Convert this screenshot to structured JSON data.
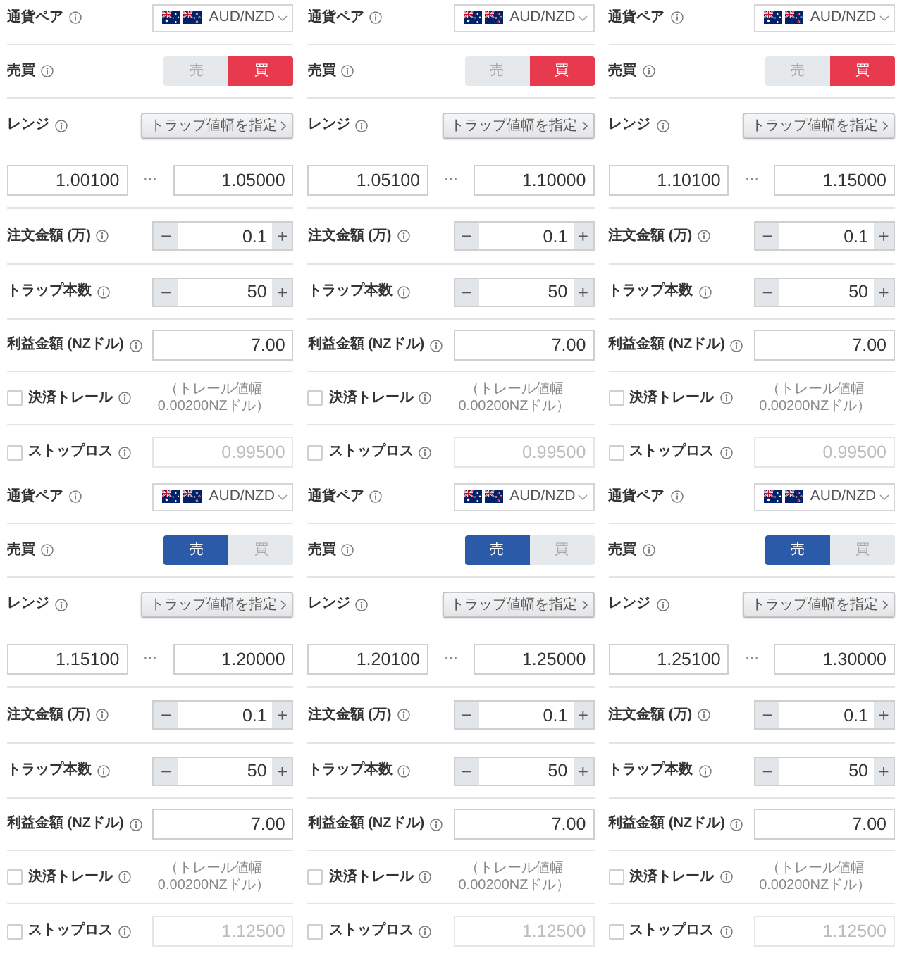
{
  "panels": [
    {
      "currency_pair": {
        "label": "通貨ペア",
        "value": "AUD/NZD"
      },
      "side": {
        "label": "売買",
        "options": [
          {
            "kind": "sell",
            "label": "売",
            "selected": false
          },
          {
            "kind": "buy",
            "label": "買",
            "selected": true
          }
        ]
      },
      "range": {
        "label": "レンジ",
        "button": "トラップ値幅を指定",
        "from": "1.00100",
        "separator": "⋯",
        "to": "1.05000"
      },
      "order_amount": {
        "label": "注文金額 (万)",
        "minus": "−",
        "value": "0.1",
        "plus": "+"
      },
      "trap_count": {
        "label": "トラップ本数",
        "minus": "−",
        "value": "50",
        "plus": "+"
      },
      "profit": {
        "label": "利益金額 (NZドル)",
        "value": "7.00"
      },
      "trail": {
        "label": "決済トレール",
        "checked": false,
        "note": "（トレール値幅 0.00200NZドル）"
      },
      "stop_loss": {
        "label": "ストップロス",
        "checked": false,
        "value": "0.99500"
      }
    },
    {
      "currency_pair": {
        "label": "通貨ペア",
        "value": "AUD/NZD"
      },
      "side": {
        "label": "売買",
        "options": [
          {
            "kind": "sell",
            "label": "売",
            "selected": false
          },
          {
            "kind": "buy",
            "label": "買",
            "selected": true
          }
        ]
      },
      "range": {
        "label": "レンジ",
        "button": "トラップ値幅を指定",
        "from": "1.05100",
        "separator": "⋯",
        "to": "1.10000"
      },
      "order_amount": {
        "label": "注文金額 (万)",
        "minus": "−",
        "value": "0.1",
        "plus": "+"
      },
      "trap_count": {
        "label": "トラップ本数",
        "minus": "−",
        "value": "50",
        "plus": "+"
      },
      "profit": {
        "label": "利益金額 (NZドル)",
        "value": "7.00"
      },
      "trail": {
        "label": "決済トレール",
        "checked": false,
        "note": "（トレール値幅 0.00200NZドル）"
      },
      "stop_loss": {
        "label": "ストップロス",
        "checked": false,
        "value": "0.99500"
      }
    },
    {
      "currency_pair": {
        "label": "通貨ペア",
        "value": "AUD/NZD"
      },
      "side": {
        "label": "売買",
        "options": [
          {
            "kind": "sell",
            "label": "売",
            "selected": false
          },
          {
            "kind": "buy",
            "label": "買",
            "selected": true
          }
        ]
      },
      "range": {
        "label": "レンジ",
        "button": "トラップ値幅を指定",
        "from": "1.10100",
        "separator": "⋯",
        "to": "1.15000"
      },
      "order_amount": {
        "label": "注文金額 (万)",
        "minus": "−",
        "value": "0.1",
        "plus": "+"
      },
      "trap_count": {
        "label": "トラップ本数",
        "minus": "−",
        "value": "50",
        "plus": "+"
      },
      "profit": {
        "label": "利益金額 (NZドル)",
        "value": "7.00"
      },
      "trail": {
        "label": "決済トレール",
        "checked": false,
        "note": "（トレール値幅 0.00200NZドル）"
      },
      "stop_loss": {
        "label": "ストップロス",
        "checked": false,
        "value": "0.99500"
      }
    },
    {
      "currency_pair": {
        "label": "通貨ペア",
        "value": "AUD/NZD"
      },
      "side": {
        "label": "売買",
        "options": [
          {
            "kind": "sell",
            "label": "売",
            "selected": true
          },
          {
            "kind": "buy",
            "label": "買",
            "selected": false
          }
        ]
      },
      "range": {
        "label": "レンジ",
        "button": "トラップ値幅を指定",
        "from": "1.15100",
        "separator": "⋯",
        "to": "1.20000"
      },
      "order_amount": {
        "label": "注文金額 (万)",
        "minus": "−",
        "value": "0.1",
        "plus": "+"
      },
      "trap_count": {
        "label": "トラップ本数",
        "minus": "−",
        "value": "50",
        "plus": "+"
      },
      "profit": {
        "label": "利益金額 (NZドル)",
        "value": "7.00"
      },
      "trail": {
        "label": "決済トレール",
        "checked": false,
        "note": "（トレール値幅 0.00200NZドル）"
      },
      "stop_loss": {
        "label": "ストップロス",
        "checked": false,
        "value": "1.12500"
      }
    },
    {
      "currency_pair": {
        "label": "通貨ペア",
        "value": "AUD/NZD"
      },
      "side": {
        "label": "売買",
        "options": [
          {
            "kind": "sell",
            "label": "売",
            "selected": true
          },
          {
            "kind": "buy",
            "label": "買",
            "selected": false
          }
        ]
      },
      "range": {
        "label": "レンジ",
        "button": "トラップ値幅を指定",
        "from": "1.20100",
        "separator": "⋯",
        "to": "1.25000"
      },
      "order_amount": {
        "label": "注文金額 (万)",
        "minus": "−",
        "value": "0.1",
        "plus": "+"
      },
      "trap_count": {
        "label": "トラップ本数",
        "minus": "−",
        "value": "50",
        "plus": "+"
      },
      "profit": {
        "label": "利益金額 (NZドル)",
        "value": "7.00"
      },
      "trail": {
        "label": "決済トレール",
        "checked": false,
        "note": "（トレール値幅 0.00200NZドル）"
      },
      "stop_loss": {
        "label": "ストップロス",
        "checked": false,
        "value": "1.12500"
      }
    },
    {
      "currency_pair": {
        "label": "通貨ペア",
        "value": "AUD/NZD"
      },
      "side": {
        "label": "売買",
        "options": [
          {
            "kind": "sell",
            "label": "売",
            "selected": true
          },
          {
            "kind": "buy",
            "label": "買",
            "selected": false
          }
        ]
      },
      "range": {
        "label": "レンジ",
        "button": "トラップ値幅を指定",
        "from": "1.25100",
        "separator": "⋯",
        "to": "1.30000"
      },
      "order_amount": {
        "label": "注文金額 (万)",
        "minus": "−",
        "value": "0.1",
        "plus": "+"
      },
      "trap_count": {
        "label": "トラップ本数",
        "minus": "−",
        "value": "50",
        "plus": "+"
      },
      "profit": {
        "label": "利益金額 (NZドル)",
        "value": "7.00"
      },
      "trail": {
        "label": "決済トレール",
        "checked": false,
        "note": "（トレール値幅 0.00200NZドル）"
      },
      "stop_loss": {
        "label": "ストップロス",
        "checked": false,
        "value": "1.12500"
      }
    }
  ]
}
